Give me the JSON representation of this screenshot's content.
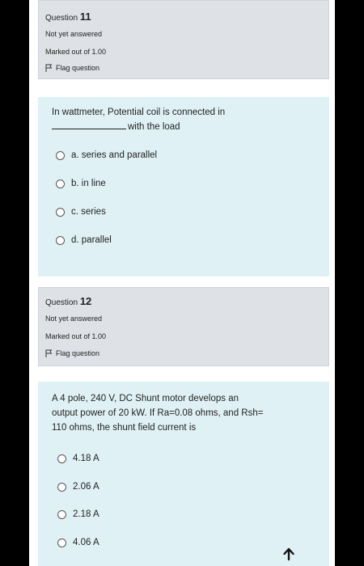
{
  "q11": {
    "label": "Question",
    "number": "11",
    "state": "Not yet answered",
    "grade": "Marked out of 1.00",
    "flag_label": "Flag question",
    "text_line1": "In wattmeter, Potential coil is connected in",
    "text_line2": "with the load",
    "options": [
      {
        "label": "a. series and parallel"
      },
      {
        "label": "b. in line"
      },
      {
        "label": "c. series"
      },
      {
        "label": "d. parallel"
      }
    ]
  },
  "q12": {
    "label": "Question",
    "number": "12",
    "state": "Not yet answered",
    "grade": "Marked out of 1.00",
    "flag_label": "Flag question",
    "text_line1": "A 4 pole, 240 V, DC Shunt motor develops an",
    "text_line2": "output power of 20 kW. If Ra=0.08 ohms, and Rsh=",
    "text_line3": "110 ohms, the shunt field current is",
    "options": [
      {
        "label": "4.18 A"
      },
      {
        "label": "2.06 A"
      },
      {
        "label": "2.18 A"
      },
      {
        "label": "4.06 A"
      }
    ]
  },
  "icons": {
    "flag": "flag-icon",
    "radio": "radio-icon",
    "scroll_top": "arrow-up-icon"
  }
}
